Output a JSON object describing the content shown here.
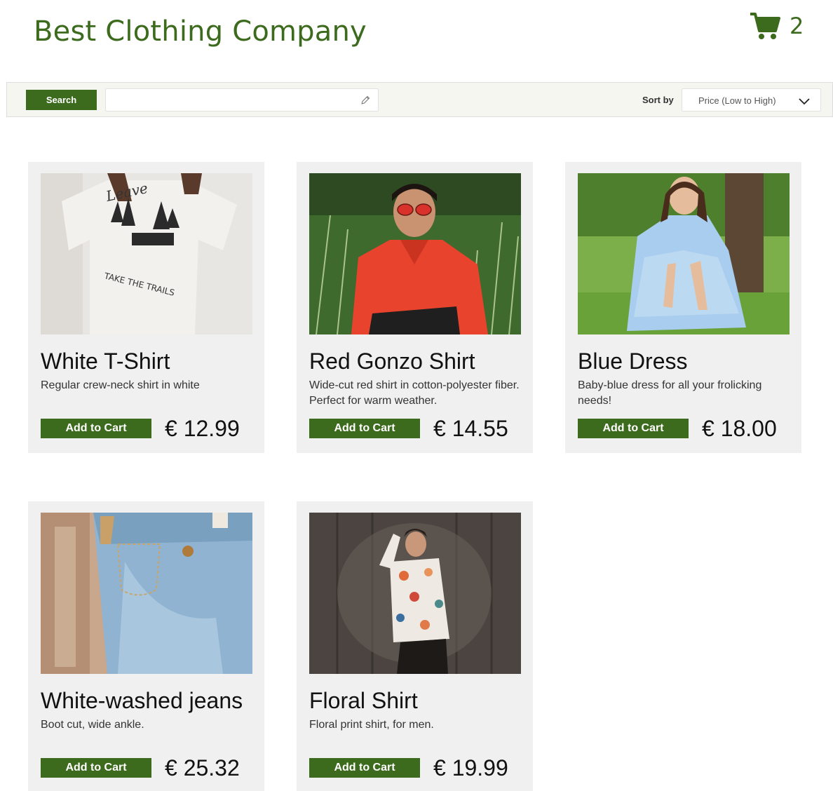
{
  "header": {
    "title": "Best Clothing Company",
    "cart_count": "2"
  },
  "colors": {
    "brand_green": "#3d6b1e",
    "card_bg": "#f0f0f0",
    "toolbar_bg": "#f6f6f1"
  },
  "toolbar": {
    "search_label": "Search",
    "search_value": "",
    "sort_label": "Sort by",
    "sort_value": "Price (Low to High)"
  },
  "products": [
    {
      "title": "White T-Shirt",
      "description": "Regular crew-neck shirt in white",
      "price": "€ 12.99",
      "button": "Add to Cart",
      "image": "white-tshirt-photo"
    },
    {
      "title": "Red Gonzo Shirt",
      "description": "Wide-cut red shirt in cotton-polyester fiber. Perfect for warm weather.",
      "price": "€ 14.55",
      "button": "Add to Cart",
      "image": "red-shirt-photo"
    },
    {
      "title": "Blue Dress",
      "description": "Baby-blue dress for all your frolicking needs!",
      "price": "€ 18.00",
      "button": "Add to Cart",
      "image": "blue-dress-photo"
    },
    {
      "title": "White-washed jeans",
      "description": "Boot cut, wide ankle.",
      "price": "€ 25.32",
      "button": "Add to Cart",
      "image": "jeans-photo"
    },
    {
      "title": "Floral Shirt",
      "description": "Floral print shirt, for men.",
      "price": "€ 19.99",
      "button": "Add to Cart",
      "image": "floral-shirt-photo"
    }
  ]
}
